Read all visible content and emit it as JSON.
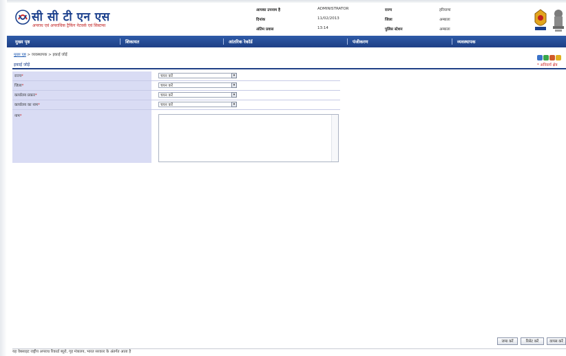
{
  "header": {
    "brand_title": "सी सी टी एन एस",
    "brand_subtitle": "अपराध एवं अपराधिक ट्रैकिंग नेटवर्क एवं सिस्टम्स",
    "user_label": "आपका उपनाम है",
    "user_value": "ADMINISTRATOR",
    "date_label": "दिनांक",
    "date_value": "11/02/2013",
    "time_label": "अंतिम प्रवास",
    "time_value": "13:14",
    "state_label": "राज्य",
    "state_value": "हरियाणा",
    "district_label": "जिला",
    "district_value": "अम्बाला",
    "ps_label": "पुलिस स्टेशन",
    "ps_value": "अम्बाला"
  },
  "nav": {
    "items": [
      {
        "label": "मुख्य पृष्ठ"
      },
      {
        "label": "शिकायत"
      },
      {
        "label": "आंतरिक रेकॉर्ड"
      },
      {
        "label": "पंजीकरण"
      },
      {
        "label": "व्यवस्थापक"
      }
    ]
  },
  "breadcrumb": {
    "home": "मुख्य पृष्ठ",
    "path": " > व्यवस्थापक > इकाई जोड़ें"
  },
  "page": {
    "title": "इकाई जोड़ें",
    "mandatory_note": "* अनिवार्य क्षेत्र"
  },
  "form": {
    "fields": [
      {
        "label": "राज्य",
        "required": "*",
        "value": "चयन करें"
      },
      {
        "label": "जिला",
        "required": "*",
        "value": "चयन करें"
      },
      {
        "label": "कार्यालय प्रकार",
        "required": "*",
        "value": "चयन करें"
      },
      {
        "label": "कार्यालय का नाम",
        "required": "*",
        "value": "चयन करें"
      }
    ],
    "textarea": {
      "label": "नाम",
      "required": "*",
      "value": ""
    }
  },
  "buttons": {
    "save": "जमा करें",
    "reset": "रिसेट करें",
    "back": "वापस करें"
  },
  "footer": {
    "text": "यह वेबसाइट राष्ट्रीय अपराध रिकार्ड ब्यूरो, गृह मंत्रालय, भारत सरकार के अंतर्गत आता है"
  },
  "colors": {
    "nav_blue": "#1e3f85",
    "label_bg": "#d9dcf4",
    "required_red": "#cc2020"
  }
}
